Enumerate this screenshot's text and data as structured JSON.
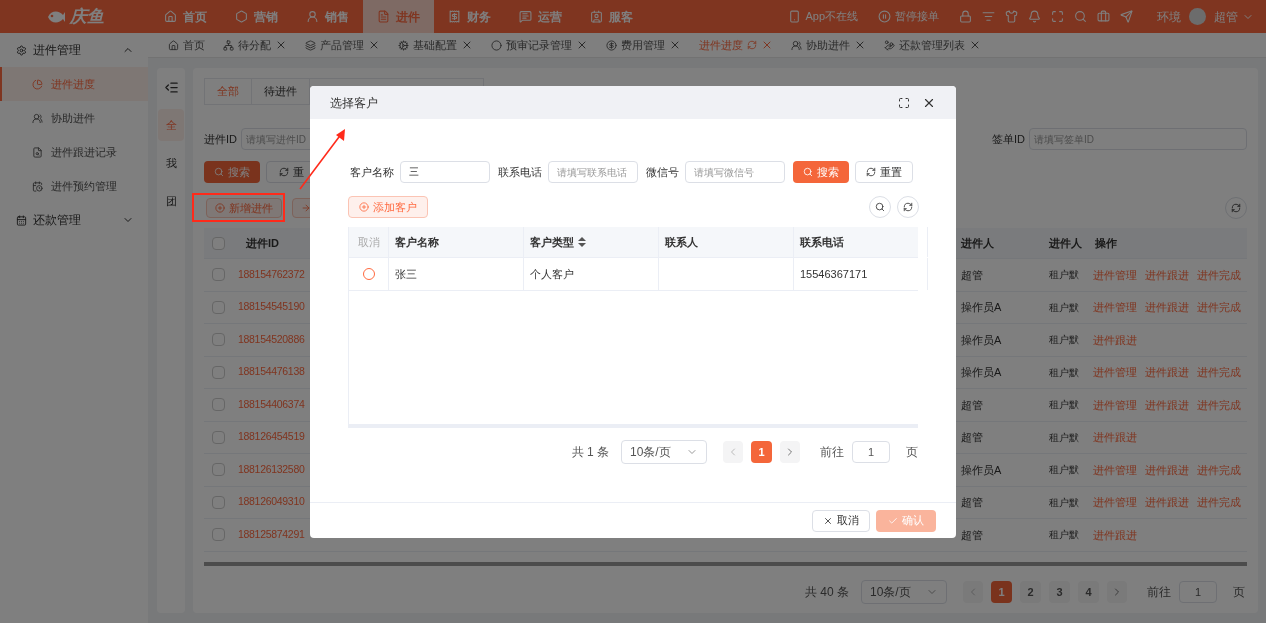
{
  "top_bar": {
    "logo": "庆鱼",
    "nav": [
      {
        "label": "首页",
        "selected": false
      },
      {
        "label": "营销",
        "selected": false
      },
      {
        "label": "销售",
        "selected": false
      },
      {
        "label": "进件",
        "selected": true
      },
      {
        "label": "财务",
        "selected": false
      },
      {
        "label": "运营",
        "selected": false
      },
      {
        "label": "服客",
        "selected": false
      }
    ],
    "status": [
      "App不在线",
      "暂停接单"
    ],
    "env": "环境",
    "user": "超管"
  },
  "tab_bar": [
    {
      "label": "首页",
      "selected": false,
      "closable": false
    },
    {
      "label": "待分配",
      "selected": false,
      "closable": true
    },
    {
      "label": "产品管理",
      "selected": false,
      "closable": true
    },
    {
      "label": "基础配置",
      "selected": false,
      "closable": true
    },
    {
      "label": "预审记录管理",
      "selected": false,
      "closable": true
    },
    {
      "label": "费用管理",
      "selected": false,
      "closable": true
    },
    {
      "label": "进件进度",
      "selected": true,
      "closable": true
    },
    {
      "label": "协助进件",
      "selected": false,
      "closable": true
    },
    {
      "label": "还款管理列表",
      "selected": false,
      "closable": true
    }
  ],
  "sidebar": [
    {
      "label": "进件管理",
      "expanded": true,
      "children": [
        {
          "label": "进件进度",
          "selected": true
        },
        {
          "label": "协助进件",
          "selected": false
        },
        {
          "label": "进件跟进记录",
          "selected": false
        },
        {
          "label": "进件预约管理",
          "selected": false
        }
      ]
    },
    {
      "label": "还款管理",
      "expanded": false
    }
  ],
  "scope_tabs": [
    {
      "label": "全",
      "selected": true
    },
    {
      "label": "我",
      "selected": false
    },
    {
      "label": "团",
      "selected": false
    }
  ],
  "main": {
    "status_tabs": [
      {
        "label": "全部",
        "selected": true
      },
      {
        "label": "待进件",
        "selected": false
      }
    ],
    "filters": [
      {
        "label": "进件ID",
        "placeholder": "请填写进件ID"
      },
      {
        "label": "签单ID",
        "placeholder": "请填写签单ID"
      }
    ],
    "search_button": "搜索",
    "reset_button": "重",
    "add_button": "新增进件",
    "table": {
      "select_all_checked": false,
      "columns": [
        "进件ID",
        "进件人",
        "进件人",
        "操作"
      ],
      "rows": [
        {
          "checked": false,
          "id": "188154762372",
          "column_2": "超管",
          "column_3": "租户默",
          "actions": [
            "进件管理",
            "进件跟进",
            "进件完成"
          ]
        },
        {
          "checked": false,
          "id": "188154545190",
          "column_2": "操作员A",
          "column_3": "租户默",
          "actions": [
            "进件管理",
            "进件跟进",
            "进件完成"
          ]
        },
        {
          "checked": false,
          "id": "188154520886",
          "column_2": "操作员A",
          "column_3": "租户默",
          "actions": [
            "进件跟进"
          ]
        },
        {
          "checked": false,
          "id": "188154476138",
          "column_2": "操作员A",
          "column_3": "租户默",
          "actions": [
            "进件管理",
            "进件跟进",
            "进件完成"
          ]
        },
        {
          "checked": false,
          "id": "188154406374",
          "column_2": "超管",
          "column_3": "租户默",
          "actions": [
            "进件管理",
            "进件跟进",
            "进件完成"
          ]
        },
        {
          "checked": false,
          "id": "188126454519",
          "column_2": "超管",
          "column_3": "租户默",
          "actions": [
            "进件跟进"
          ]
        },
        {
          "checked": false,
          "id": "188126132580",
          "column_2": "操作员A",
          "column_3": "租户默",
          "actions": [
            "进件管理",
            "进件跟进",
            "进件完成"
          ]
        },
        {
          "checked": false,
          "id": "188126049310",
          "column_2": "超管",
          "column_3": "租户默",
          "actions": [
            "进件管理",
            "进件跟进",
            "进件完成"
          ]
        },
        {
          "checked": false,
          "id": "188125874291",
          "column_2": "超管",
          "column_3": "租户默",
          "actions": [
            "进件跟进"
          ]
        }
      ]
    },
    "pagination": {
      "total": "共 40 条",
      "page_size": "10条/页",
      "pages": [
        {
          "label": "1",
          "selected": true
        },
        {
          "label": "2",
          "selected": false
        },
        {
          "label": "3",
          "selected": false
        },
        {
          "label": "4",
          "selected": false
        }
      ],
      "goto_label": "前往",
      "goto_value": "1",
      "page_unit": "页"
    }
  },
  "modal": {
    "title": "选择客户",
    "filters": [
      {
        "label": "客户名称",
        "value": "三"
      },
      {
        "label": "联系电话",
        "placeholder": "请填写联系电话"
      },
      {
        "label": "微信号",
        "placeholder": "请填写微信号"
      }
    ],
    "search_button": "搜索",
    "reset_button": "重置",
    "add_button": "添加客户",
    "table": {
      "columns": [
        {
          "label": "取消",
          "kind": "action"
        },
        {
          "label": "客户名称",
          "kind": "text"
        },
        {
          "label": "客户类型",
          "kind": "sortable"
        },
        {
          "label": "联系人",
          "kind": "text"
        },
        {
          "label": "联系电话",
          "kind": "text"
        }
      ],
      "rows": [
        {
          "selected": false,
          "name": "张三",
          "type": "个人客户",
          "phone": "15546367171"
        }
      ]
    },
    "pagination": {
      "total": "共 1 条",
      "page_size": "10条/页",
      "pages": [
        {
          "label": "1",
          "selected": true
        }
      ],
      "goto_label": "前往",
      "goto_value": "1",
      "page_unit": "页"
    },
    "cancel_button": "取消",
    "confirm_button": {
      "label": "确认",
      "disabled": true
    }
  }
}
